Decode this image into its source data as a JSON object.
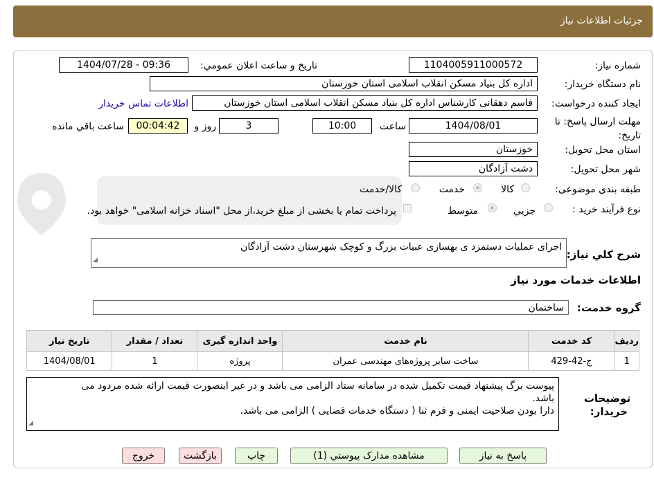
{
  "header": {
    "title": "جزئیات اطلاعات نیاز"
  },
  "fields": {
    "need_number_label": "شماره نیاز:",
    "need_number": "1104005911000572",
    "announce_label": "تاریخ و ساعت اعلان عمومي:",
    "announce_value": "1404/07/28 - 09:36",
    "buyer_org_label": "نام دستگاه خريدار:",
    "buyer_org": "اداره کل بنیاد مسکن انقلاب اسلامی استان خوزستان",
    "requester_label": "ايجاد کننده درخواست:",
    "requester": "قاسم دهقانی کارشناس اداره کل بنیاد مسکن انقلاب اسلامی استان خوزستان",
    "buyer_contact_link": "اطلاعات تماس خريدار",
    "deadline_label": "مهلت ارسال پاسخ: تا تاریخ:",
    "deadline_date": "1404/08/01",
    "hour_label": "ساعت",
    "deadline_time": "10:00",
    "days_value": "3",
    "days_label": "روز و",
    "remaining_time": "00:04:42",
    "remaining_label": "ساعت باقي مانده",
    "province_label": "استان محل تحويل:",
    "province": "خوزستان",
    "city_label": "شهر محل تحويل:",
    "city": "دشت آزادگان",
    "category_label": "طبقه بندی موضوعی:",
    "category_options": [
      "کالا",
      "خدمت",
      "کالا/خدمت"
    ],
    "purchase_label": "نوع فرآيند خريد :",
    "purchase_options": [
      "جزيي",
      "متوسط"
    ],
    "payment_note": "پرداخت تمام يا بخشی از مبلغ خريد،از محل \"اسناد خزانه اسلامی\" خواهد بود."
  },
  "description": {
    "label": "شرح کلي نياز:",
    "text": "اجرای عملیات دستمزد ی  بهسازی عبیات بزرگ و کوچک   شهرستان  دشت آزادگان"
  },
  "services": {
    "section_title": "اطلاعات خدمات مورد نياز",
    "group_label": "گروه خدمت:",
    "group_value": "ساختمان",
    "columns": [
      "رديف",
      "کد خدمت",
      "نام خدمت",
      "واحد اندازه گيری",
      "تعداد / مقدار",
      "تاريخ نياز"
    ],
    "rows": [
      [
        "1",
        "ج-42-429",
        "ساخت ساير پروژه‌های مهندسی عمران",
        "پروژه",
        "1",
        "1404/08/01"
      ]
    ]
  },
  "buyer_notes": {
    "label_line1": "توضيحات",
    "label_line2": "خريدار:",
    "line1": "پیوست برگ پیشنهاد قیمت تکمیل شده در سامانه ستاد الزامی می باشد و در غیر اینصورت  قیمت ارائه شده مردود می",
    "line2": "باشد.",
    "line3": "دارا بودن صلاحیت ایمنی و فرم ثنا ( دستگاه خدمات قضایی ) الزامی می باشد."
  },
  "buttons": {
    "respond": "پاسخ به نياز",
    "attachments": "مشاهده مدارک پيوستي (1)",
    "print": "چاپ",
    "back": "بازگشت",
    "exit": "خروج"
  },
  "colors": {
    "header_bg": "#8b6f3c",
    "button_green": "#e6f8dc",
    "button_pink": "#fcdede",
    "remaining_bg": "#ffffcc",
    "link": "#1a0dab"
  }
}
